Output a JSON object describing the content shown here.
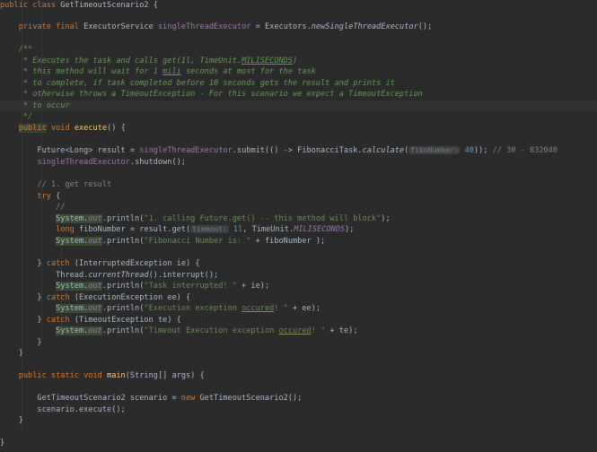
{
  "class_decl": {
    "kw": "public class",
    "name": "GetTimeoutScenario2",
    "brace": "{"
  },
  "field": {
    "mods": "private final",
    "type": "ExecutorService",
    "name": "singleThreadExecutor",
    "assign": "=",
    "cls": "Executors.",
    "method": "newSingleThreadExecutor",
    "tail": "();"
  },
  "javadoc": {
    "open": "/**",
    "l1a": " * Executes the task and calls get(1l, TimeUnit.",
    "l1b": "MILISECONDS",
    "l1c": ")",
    "l2a": " * this method will wait for 1 ",
    "l2b": "mili",
    "l2c": " seconds at most for the task",
    "l3": " * to complete, if task completed before 10 seconds gets the result and prints it",
    "l4": " * otherwise throws a TimeoutException - For this scenario we expect a TimeoutException",
    "l5": " * to occur",
    "close": " */"
  },
  "execute_decl": {
    "pub": "public",
    "void": "void",
    "name": "execute",
    "rest": "() {"
  },
  "future": {
    "a": "Future<Long> result = ",
    "exec": "singleThreadExecutor",
    "b": ".submit(() -> FibonacciTask.",
    "m": "calculate",
    "c": "(",
    "hint": "fiboNumber:",
    "num": "40",
    "d": ")); ",
    "cmt": "// 30 - 832040"
  },
  "shutdown": {
    "exec": "singleThreadExecutor",
    "rest": ".shutdown();"
  },
  "cmt_get": "// 1. get result",
  "try_kw": "try",
  "try_brace": " {",
  "cmt_slashes": "//",
  "sys1": {
    "sys": "System.",
    "out": "out",
    "a": ".println(",
    "str": "\"1. calling Future.get() -- this method will block\"",
    "b": ");"
  },
  "long_line": {
    "kw": "long",
    "a": " fiboNumber = result.get(",
    "hint": "timeout:",
    "num": "1l",
    "b": ", TimeUnit.",
    "c": "MILISECONDS",
    "d": ");"
  },
  "sys2": {
    "sys": "System.",
    "out": "out",
    "a": ".println(",
    "str": "\"Fibonacci Number is: \"",
    "b": " + fiboNumber );"
  },
  "catch1": {
    "a": "} ",
    "kw": "catch",
    "b": " (InterruptedException ie) {"
  },
  "thread_line": {
    "a": "Thread.",
    "m": "currentThread",
    "b": "().interrupt();"
  },
  "sys3": {
    "sys": "System.",
    "out": "out",
    "a": ".println(",
    "str": "\"Task interrupted! \"",
    "b": " + ie);"
  },
  "catch2": {
    "a": "} ",
    "kw": "catch",
    "b": " (ExecutionException ee) {"
  },
  "sys4": {
    "sys": "System.",
    "out": "out",
    "a": ".println(",
    "str1": "\"Execution exception ",
    "str2": "occured",
    "str3": "! \"",
    "b": " + ee);"
  },
  "catch3": {
    "a": "} ",
    "kw": "catch",
    "b": " (TimeoutException te) {"
  },
  "sys5": {
    "sys": "System.",
    "out": "out",
    "a": ".println(",
    "str1": "\"Timeout Execution exception ",
    "str2": "occured",
    "str3": "! \"",
    "b": " + te);"
  },
  "close_brace": "}",
  "main_decl": {
    "kw": "public static void",
    "name": "main",
    "rest": "(String[] args) {"
  },
  "scenario_new": {
    "a": "GetTimeoutScenario2 scenario = ",
    "kw": "new",
    "b": " GetTimeoutScenario2();"
  },
  "scenario_exec": "scenario.execute();",
  "colors": {
    "background": "#2b2b2b",
    "keyword": "#cc7832",
    "string": "#6a8759",
    "field": "#9876aa",
    "method": "#ffc66d",
    "comment": "#808080",
    "javadoc": "#629755",
    "number": "#6897bb"
  }
}
